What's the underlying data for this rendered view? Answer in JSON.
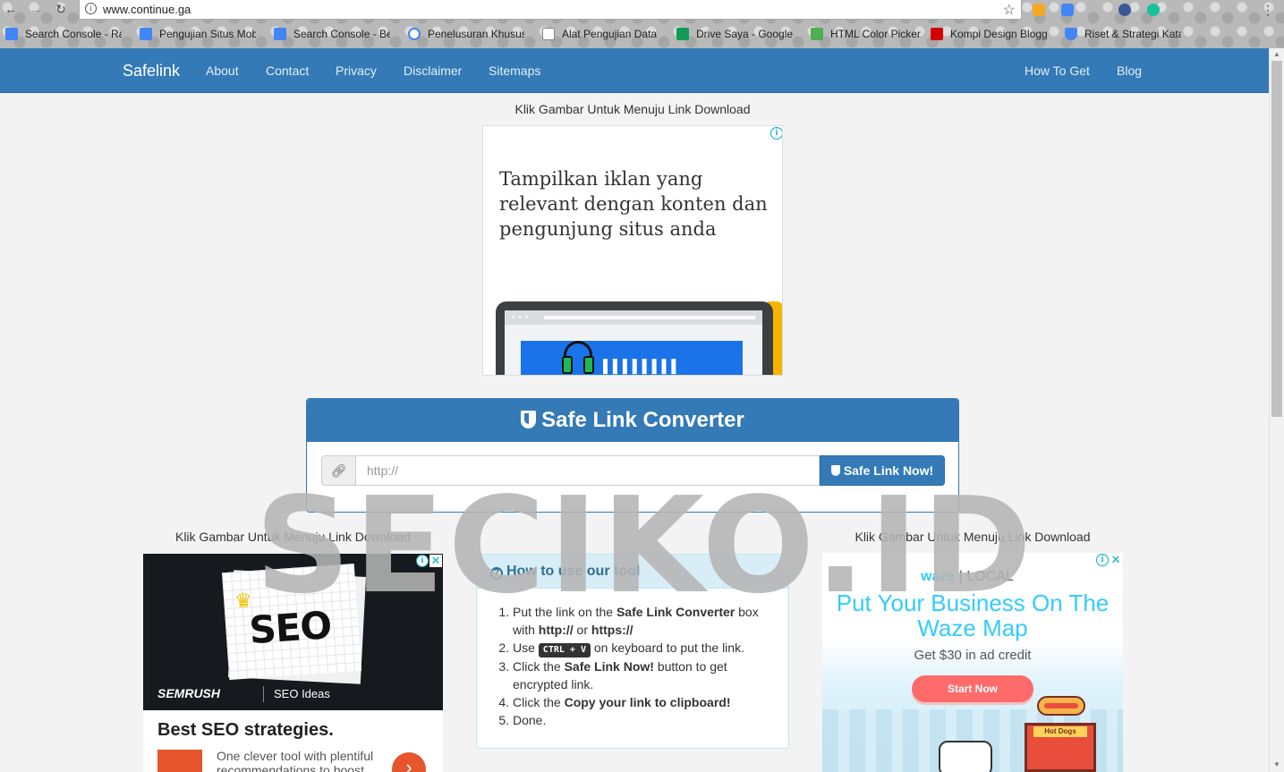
{
  "browser": {
    "url": "www.continue.ga",
    "bookmarks": [
      {
        "label": "Search Console - Ra",
        "icon": "search-console-icon",
        "color": "#4285f4"
      },
      {
        "label": "Pengujian Situs Mob",
        "icon": "search-console-icon",
        "color": "#4285f4"
      },
      {
        "label": "Search Console - Ber",
        "icon": "search-console-icon",
        "color": "#4285f4"
      },
      {
        "label": "Penelusuran Khusus",
        "icon": "google-icon",
        "color": "#4285f4"
      },
      {
        "label": "Alat Pengujian Data",
        "icon": "document-icon",
        "color": "#888888"
      },
      {
        "label": "Drive Saya - Google",
        "icon": "google-drive-icon",
        "color": "#0f9d58"
      },
      {
        "label": "HTML Color Picker",
        "icon": "w3schools-icon",
        "color": "#4caf50"
      },
      {
        "label": "Kompi Design Blogge",
        "icon": "kompi-icon",
        "color": "#d50000"
      },
      {
        "label": "Riset & Strategi Kata",
        "icon": "google-ads-icon",
        "color": "#4285f4"
      }
    ]
  },
  "navbar": {
    "brand": "Safelink",
    "links": [
      "About",
      "Contact",
      "Privacy",
      "Disclaimer",
      "Sitemaps"
    ],
    "right_links": [
      "How To Get",
      "Blog"
    ],
    "color": "#337ab7"
  },
  "captions": {
    "top": "Klik Gambar Untuk Menuju Link Download",
    "left": "Klik Gambar Untuk Menuju Link Download",
    "right": "Klik Gambar Untuk Menuju Link Download"
  },
  "ad_top": {
    "headline": "Tampilkan iklan yang relevant dengan konten dan pengunjung situs anda",
    "adchoices": "i"
  },
  "converter": {
    "title": "Safe Link Converter",
    "placeholder": "http://",
    "button_label": "Safe Link Now!"
  },
  "ad_left": {
    "image_text": "SEO",
    "brand": "SEMRUSH",
    "brand_sub": "SEO Ideas",
    "title": "Best SEO strategies.",
    "description": "One clever tool with plentiful recommendations to boost"
  },
  "howto": {
    "title": "How to use our tool",
    "steps": {
      "s1_pre": "Put the link on the ",
      "s1_bold": "Safe Link Converter",
      "s1_mid": " box with ",
      "s1_b2": "http://",
      "s1_or": " or ",
      "s1_b3": "https://",
      "s2_pre": "Use ",
      "s2_kbd": "CTRL + V",
      "s2_post": " on keyboard to put the link.",
      "s3_pre": "Click the ",
      "s3_bold": "Safe Link Now!",
      "s3_post": " button to get encrypted link.",
      "s4_pre": "Click the ",
      "s4_bold": "Copy your link to clipboard!",
      "s5": "Done."
    }
  },
  "ad_right": {
    "brand": "waze",
    "brand_sub": "| LOCAL",
    "headline": "Put Your Business On The Waze Map",
    "sub": "Get $30 in ad credit",
    "cta": "Start Now",
    "shop_sign": "Hot Dogs"
  },
  "watermark": "SECIKO.ID"
}
